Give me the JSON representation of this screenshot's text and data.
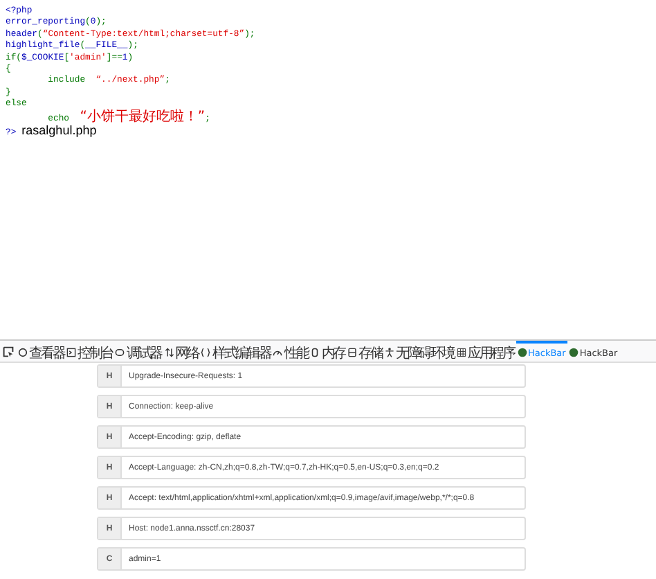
{
  "code_lines": [
    {
      "segments": [
        {
          "text": "<?php",
          "kind": "default"
        }
      ]
    },
    {
      "segments": [
        {
          "text": "error_reporting",
          "kind": "default"
        },
        {
          "text": "(",
          "kind": "keyword"
        },
        {
          "text": "0",
          "kind": "default"
        },
        {
          "text": ");",
          "kind": "keyword"
        }
      ]
    },
    {
      "segments": [
        {
          "text": "header",
          "kind": "default"
        },
        {
          "text": "(",
          "kind": "keyword"
        },
        {
          "text": "“Content-Type:text/html;charset=utf-8”",
          "kind": "string"
        },
        {
          "text": ");",
          "kind": "keyword"
        }
      ]
    },
    {
      "segments": [
        {
          "text": "highlight_file",
          "kind": "default"
        },
        {
          "text": "(",
          "kind": "keyword"
        },
        {
          "text": "__FILE__",
          "kind": "default"
        },
        {
          "text": ");",
          "kind": "keyword"
        }
      ]
    },
    {
      "segments": [
        {
          "text": "if(",
          "kind": "keyword"
        },
        {
          "text": "$_COOKIE",
          "kind": "default"
        },
        {
          "text": "[",
          "kind": "keyword"
        },
        {
          "text": "'admin'",
          "kind": "string"
        },
        {
          "text": "]==",
          "kind": "keyword"
        },
        {
          "text": "1",
          "kind": "default"
        },
        {
          "text": ")",
          "kind": "keyword"
        }
      ]
    },
    {
      "segments": [
        {
          "text": "{",
          "kind": "keyword"
        }
      ]
    },
    {
      "segments": [
        {
          "text": "        include  ",
          "kind": "keyword"
        },
        {
          "text": "“../next.php”",
          "kind": "string"
        },
        {
          "text": ";",
          "kind": "keyword"
        }
      ]
    },
    {
      "segments": [
        {
          "text": "}",
          "kind": "keyword"
        }
      ]
    },
    {
      "segments": [
        {
          "text": "else",
          "kind": "keyword"
        }
      ]
    },
    {
      "segments": [
        {
          "text": "        echo  ",
          "kind": "keyword"
        },
        {
          "text": "“小饼干最好吃啦！”",
          "kind": "string"
        },
        {
          "text": ";",
          "kind": "keyword"
        }
      ]
    },
    {
      "segments": [
        {
          "text": "?>",
          "kind": "default"
        }
      ]
    }
  ],
  "output_text": "rasalghul.php",
  "devtools_tabs": [
    {
      "label": "查看器",
      "selected": false
    },
    {
      "label": "控制台",
      "selected": false
    },
    {
      "label": "调试器",
      "selected": false
    },
    {
      "label": "网络",
      "selected": false
    },
    {
      "label": "样式编辑器",
      "selected": false
    },
    {
      "label": "性能",
      "selected": false
    },
    {
      "label": "内存",
      "selected": false
    },
    {
      "label": "存储",
      "selected": false
    },
    {
      "label": "无障碍环境",
      "selected": false
    },
    {
      "label": "应用程序",
      "selected": false
    },
    {
      "label": "HackBar",
      "selected": true
    },
    {
      "label": "HackBar",
      "selected": false
    }
  ],
  "hackbar_rows": [
    {
      "tag": "H",
      "value": "Upgrade-Insecure-Requests: 1"
    },
    {
      "tag": "H",
      "value": "Connection: keep-alive"
    },
    {
      "tag": "H",
      "value": "Accept-Encoding: gzip, deflate"
    },
    {
      "tag": "H",
      "value": "Accept-Language: zh-CN,zh;q=0.8,zh-TW;q=0.7,zh-HK;q=0.5,en-US;q=0.3,en;q=0.2"
    },
    {
      "tag": "H",
      "value": "Accept: text/html,application/xhtml+xml,application/xml;q=0.9,image/avif,image/webp,*/*;q=0.8"
    },
    {
      "tag": "H",
      "value": "Host: node1.anna.nssctf.cn:28037"
    },
    {
      "tag": "C",
      "value": "admin=1"
    }
  ]
}
